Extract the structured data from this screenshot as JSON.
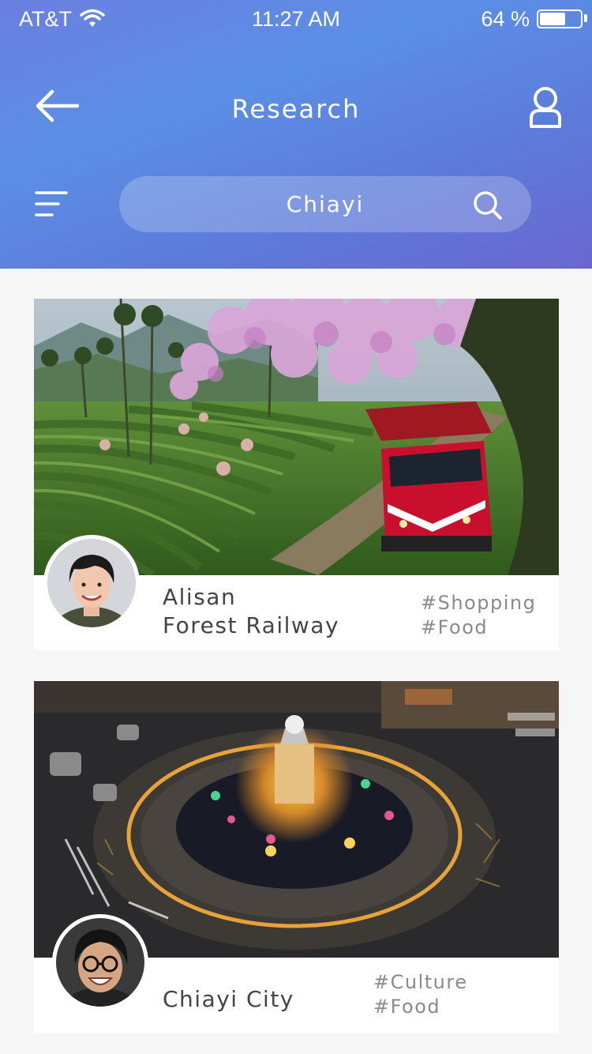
{
  "status_bar": {
    "carrier": "AT&T",
    "time": "11:27 AM",
    "battery_text": "64 %",
    "battery_level": 0.64
  },
  "header": {
    "title": "Research"
  },
  "search": {
    "value": "Chiayi"
  },
  "cards": [
    {
      "name_line1": "Alisan",
      "name_line2": "Forest Railway",
      "tags": [
        "#Shopping",
        "#Food"
      ]
    },
    {
      "name_line1": "Chiayi City",
      "name_line2": "",
      "tags": [
        "#Culture",
        "#Food"
      ]
    }
  ]
}
